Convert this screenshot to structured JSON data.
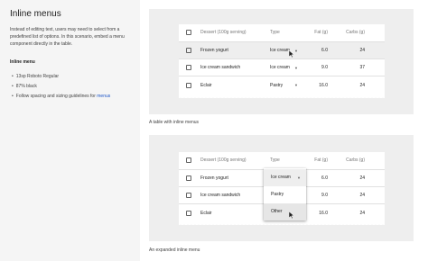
{
  "sidebar": {
    "title": "Inline menus",
    "description": "Instead of editing text, users may need to select from a predefined list of options. In this scenario, embed a menu component directly in the table.",
    "subheading": "Inline menu",
    "bullets": [
      "13sp Roboto Regular",
      "87% black"
    ],
    "last_bullet_prefix": "Follow spacing and sizing guidelines for",
    "last_bullet_link": "menus"
  },
  "table_headers": {
    "dessert": "Dessert (100g serving)",
    "type": "Type",
    "fat": "Fat (g)",
    "carbs": "Carbs (g)"
  },
  "example1": {
    "caption": "A table with inline menus",
    "rows": [
      {
        "name": "Frozen yogurt",
        "type": "Ice cream",
        "fat": "6.0",
        "carbs": "24"
      },
      {
        "name": "Ice cream sandwich",
        "type": "Ice cream",
        "fat": "9.0",
        "carbs": "37"
      },
      {
        "name": "Eclair",
        "type": "Pastry",
        "fat": "16.0",
        "carbs": "24"
      }
    ]
  },
  "example2": {
    "caption": "An expanded inline menu",
    "rows": [
      {
        "name": "Frozen yogurt",
        "fat": "6.0",
        "carbs": "24"
      },
      {
        "name": "Ice cream sandwich",
        "fat": "9.0",
        "carbs": "24"
      },
      {
        "name": "Eclair",
        "fat": "16.0",
        "carbs": "24"
      }
    ],
    "menu_options": [
      "Ice cream",
      "Pastry",
      "Other"
    ],
    "menu_selected": "Ice cream"
  },
  "icons": {
    "dropdown": "arrow-drop-down-icon",
    "cursor": "pointer-cursor-icon",
    "checkbox": "checkbox-icon"
  }
}
